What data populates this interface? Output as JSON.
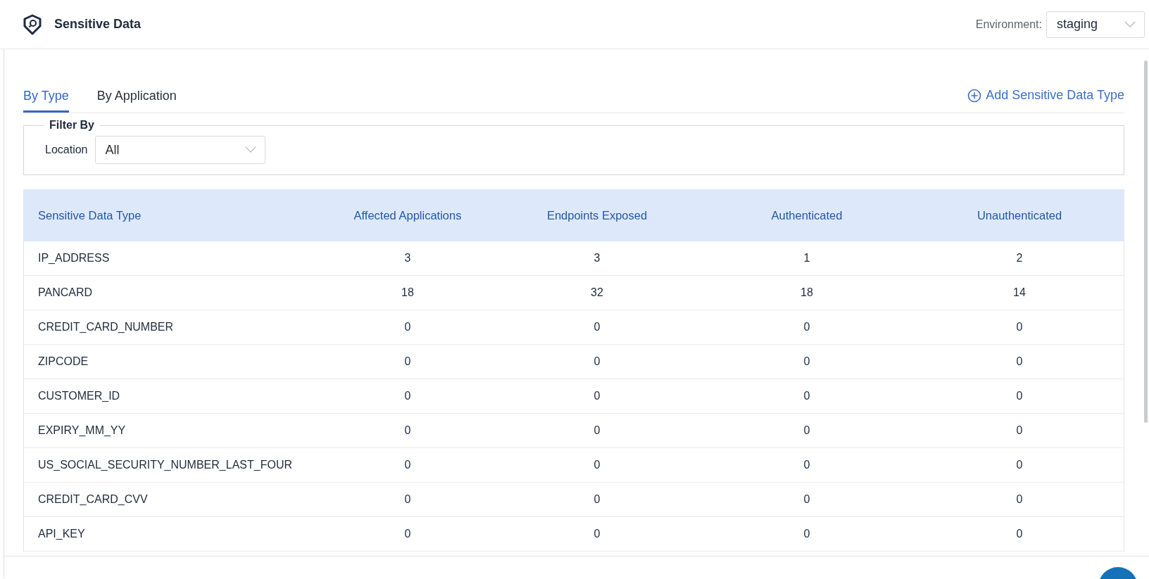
{
  "header": {
    "title": "Sensitive Data",
    "environment": {
      "label": "Environment:",
      "value": "staging"
    }
  },
  "tabs": [
    {
      "label": "By Type",
      "selected": true
    },
    {
      "label": "By Application",
      "selected": false
    }
  ],
  "add_button": {
    "label": "Add Sensitive Data Type"
  },
  "filter": {
    "legend": "Filter By",
    "location": {
      "label": "Location",
      "value": "All"
    }
  },
  "table": {
    "columns": [
      "Sensitive Data Type",
      "Affected Applications",
      "Endpoints Exposed",
      "Authenticated",
      "Unauthenticated"
    ],
    "rows": [
      [
        "IP_ADDRESS",
        "3",
        "3",
        "1",
        "2"
      ],
      [
        "PANCARD",
        "18",
        "32",
        "18",
        "14"
      ],
      [
        "CREDIT_CARD_NUMBER",
        "0",
        "0",
        "0",
        "0"
      ],
      [
        "ZIPCODE",
        "0",
        "0",
        "0",
        "0"
      ],
      [
        "CUSTOMER_ID",
        "0",
        "0",
        "0",
        "0"
      ],
      [
        "EXPIRY_MM_YY",
        "0",
        "0",
        "0",
        "0"
      ],
      [
        "US_SOCIAL_SECURITY_NUMBER_LAST_FOUR",
        "0",
        "0",
        "0",
        "0"
      ],
      [
        "CREDIT_CARD_CVV",
        "0",
        "0",
        "0",
        "0"
      ],
      [
        "API_KEY",
        "0",
        "0",
        "0",
        "0"
      ]
    ]
  }
}
